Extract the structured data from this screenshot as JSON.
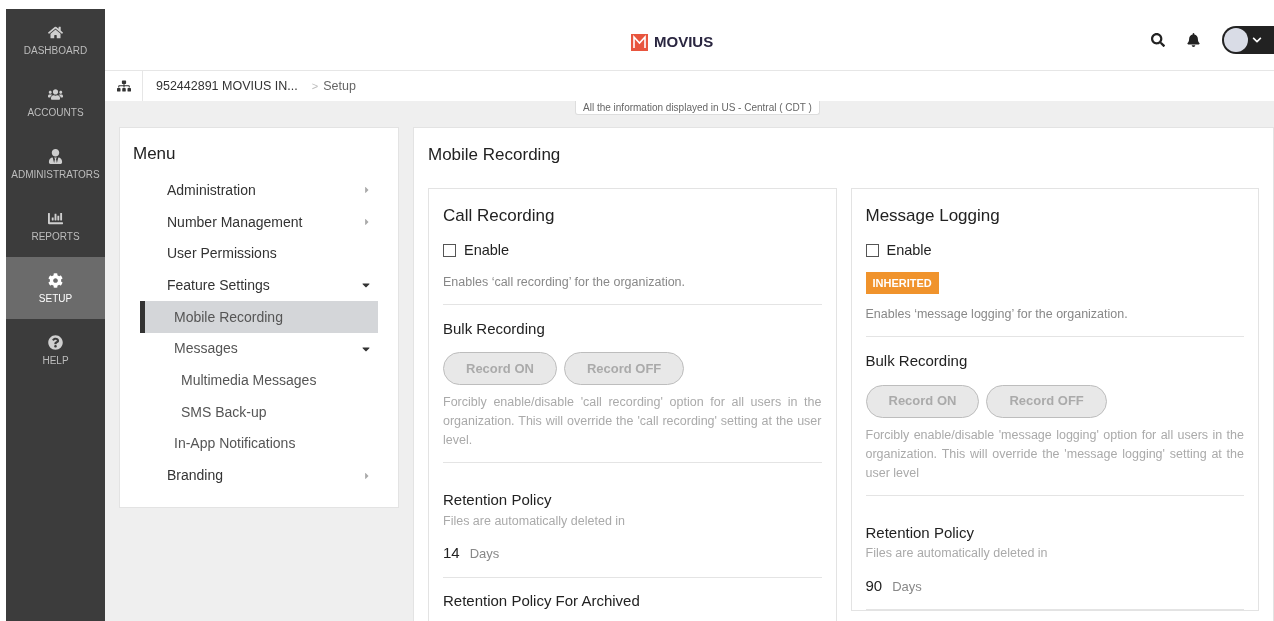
{
  "nav": [
    {
      "label": "DASHBOARD",
      "selected": false
    },
    {
      "label": "ACCOUNTS",
      "selected": false
    },
    {
      "label": "ADMINISTRATORS",
      "selected": false
    },
    {
      "label": "REPORTS",
      "selected": false
    },
    {
      "label": "SETUP",
      "selected": true
    },
    {
      "label": "HELP",
      "selected": false
    }
  ],
  "header": {
    "logo": "MOVIUS"
  },
  "breadcrumb": {
    "items": [
      "952442891 MOVIUS IN...",
      "Setup"
    ],
    "separator": ">"
  },
  "timezone_notice": "All the information displayed in US - Central ( CDT )",
  "menu": {
    "title": "Menu",
    "items": [
      {
        "label": "Administration",
        "expanded": false,
        "selected": false
      },
      {
        "label": "Number Management",
        "expanded": false,
        "selected": false
      },
      {
        "label": "User Permissions",
        "selected": false
      },
      {
        "label": "Feature Settings",
        "expanded": true,
        "selected": false,
        "children": [
          {
            "label": "Mobile Recording",
            "selected": true
          },
          {
            "label": "Messages",
            "expanded": true,
            "selected": false,
            "children": [
              {
                "label": "Multimedia Messages",
                "selected": false
              },
              {
                "label": "SMS Back-up",
                "selected": false
              }
            ]
          },
          {
            "label": "In-App Notifications",
            "selected": false
          }
        ]
      },
      {
        "label": "Branding",
        "expanded": false,
        "selected": false
      }
    ]
  },
  "page": {
    "title": "Mobile Recording",
    "cards": [
      {
        "title": "Call Recording",
        "enable": {
          "label": "Enable",
          "checked": false
        },
        "description": "Enables ‘call recording’ for the organization.",
        "bulk": {
          "title": "Bulk Recording",
          "buttons": [
            {
              "label": "Record ON",
              "disabled": true
            },
            {
              "label": "Record OFF",
              "disabled": true
            }
          ],
          "description": "Forcibly enable/disable 'call recording' option for all users in the organization. This will override the 'call recording' setting at the user level."
        },
        "retention": {
          "title": "Retention Policy",
          "subtitle": "Files are automatically deleted in",
          "value": "14",
          "unit": "Days"
        },
        "archived_title": "Retention Policy For Archived"
      },
      {
        "title": "Message Logging",
        "enable": {
          "label": "Enable",
          "checked": false
        },
        "badge": "INHERITED",
        "description": "Enables ‘message logging’ for the organization.",
        "bulk": {
          "title": "Bulk Recording",
          "buttons": [
            {
              "label": "Record ON",
              "disabled": true
            },
            {
              "label": "Record OFF",
              "disabled": true
            }
          ],
          "description": "Forcibly enable/disable 'message logging' option for all users in the organization. This will override the 'message logging' setting at the user level"
        },
        "retention": {
          "title": "Retention Policy",
          "subtitle": "Files are automatically deleted in",
          "value": "90",
          "unit": "Days"
        }
      }
    ]
  }
}
